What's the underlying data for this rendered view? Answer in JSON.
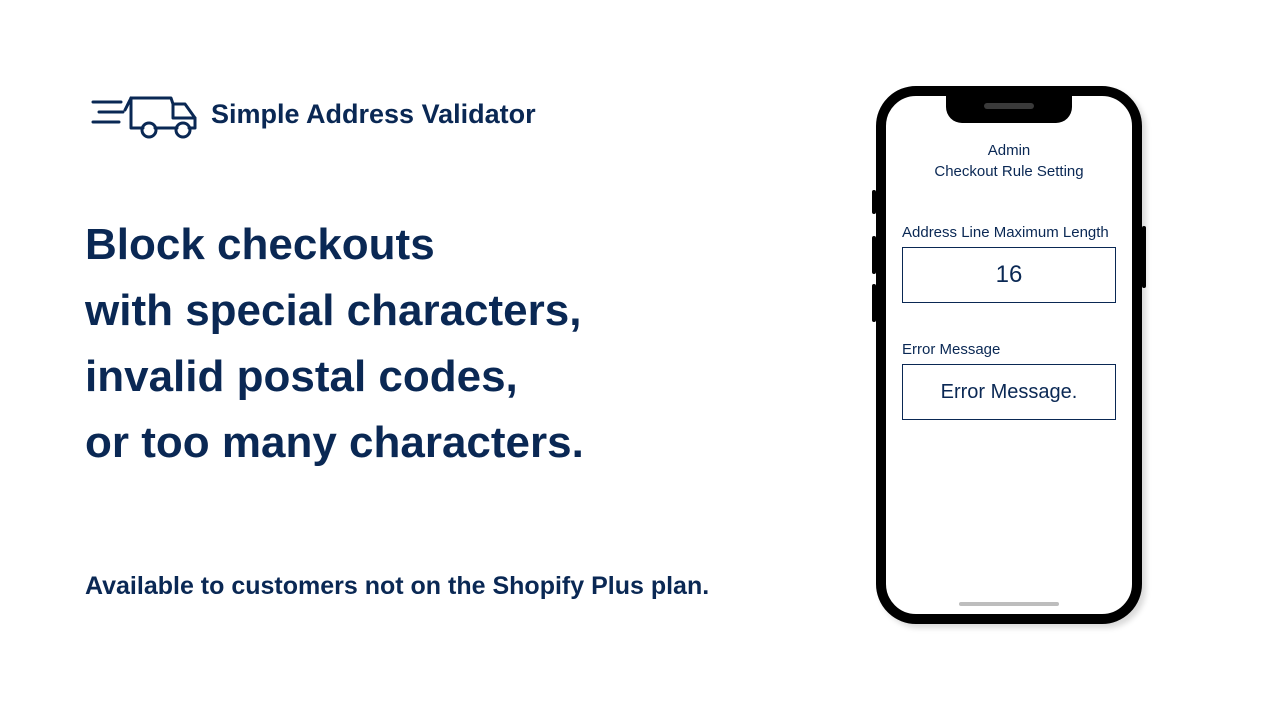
{
  "app": {
    "name": "Simple Address Validator"
  },
  "headline": "Block checkouts\nwith special characters,\ninvalid postal codes,\nor too many characters.",
  "subline": "Available to customers not on the Shopify Plus plan.",
  "phone": {
    "title": "Admin\nCheckout Rule Setting",
    "field1": {
      "label": "Address Line Maximum Length",
      "value": "16"
    },
    "field2": {
      "label": "Error Message",
      "value": "Error Message."
    }
  }
}
